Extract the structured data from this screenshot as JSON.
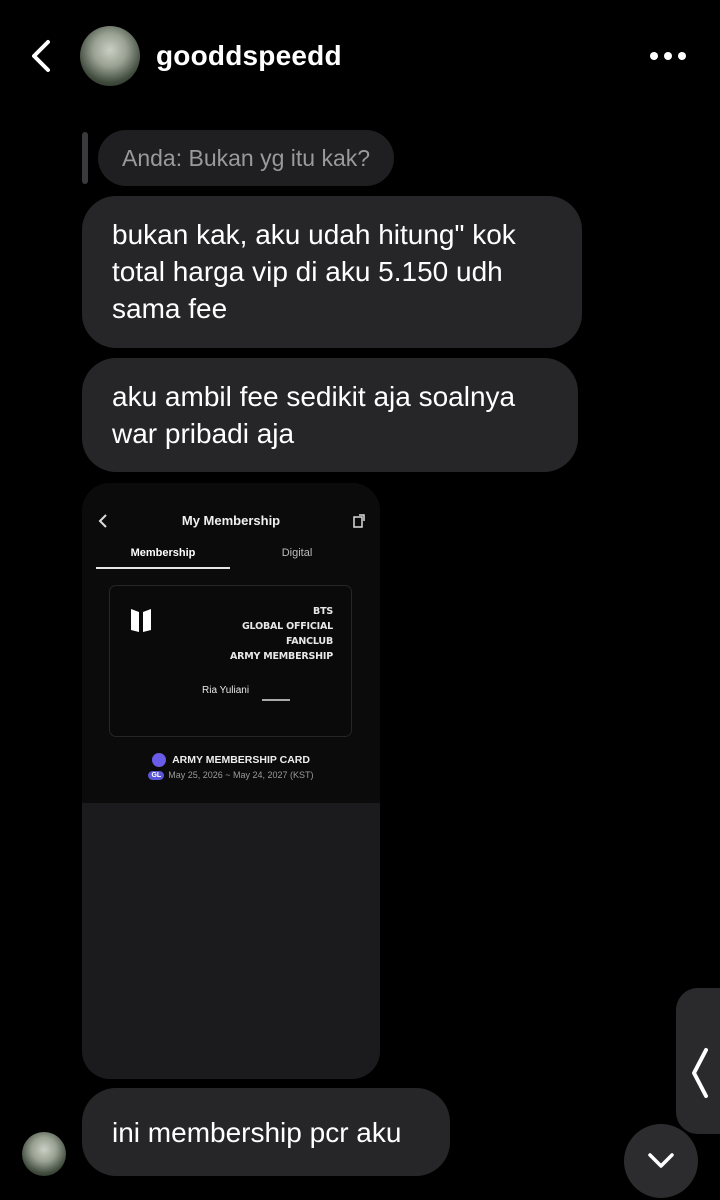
{
  "header": {
    "username": "gooddspeedd",
    "back_icon": "chevron-left-icon",
    "more_icon": "more-horizontal-icon"
  },
  "reply_preview": {
    "text": "Anda: Bukan yg itu kak?"
  },
  "messages": [
    {
      "text": "bukan kak, aku udah hitung\" kok total harga vip di aku 5.150 udh sama fee"
    },
    {
      "text": "aku ambil fee sedikit aja soalnya war pribadi aja"
    },
    {
      "text": "ini membership pcr aku"
    }
  ],
  "screenshot_image": {
    "title": "My Membership",
    "tabs": [
      "Membership",
      "Digital"
    ],
    "card_lines": [
      "BTS",
      "GLOBAL OFFICIAL",
      "FANCLUB",
      "ARMY MEMBERSHIP"
    ],
    "card_name": "Ria Yuliani",
    "card_label": "ARMY MEMBERSHIP CARD",
    "gl_badge": "GL",
    "date_range": "May 25, 2026 ~ May 24, 2027 (KST)"
  },
  "colors": {
    "background": "#000000",
    "bubble": "#262628",
    "reply_pill": "#1f1f21",
    "reply_text": "#9a9a9e"
  },
  "controls": {
    "side_handle_icon": "chevron-left-icon",
    "scroll_down_icon": "chevron-down-icon"
  }
}
